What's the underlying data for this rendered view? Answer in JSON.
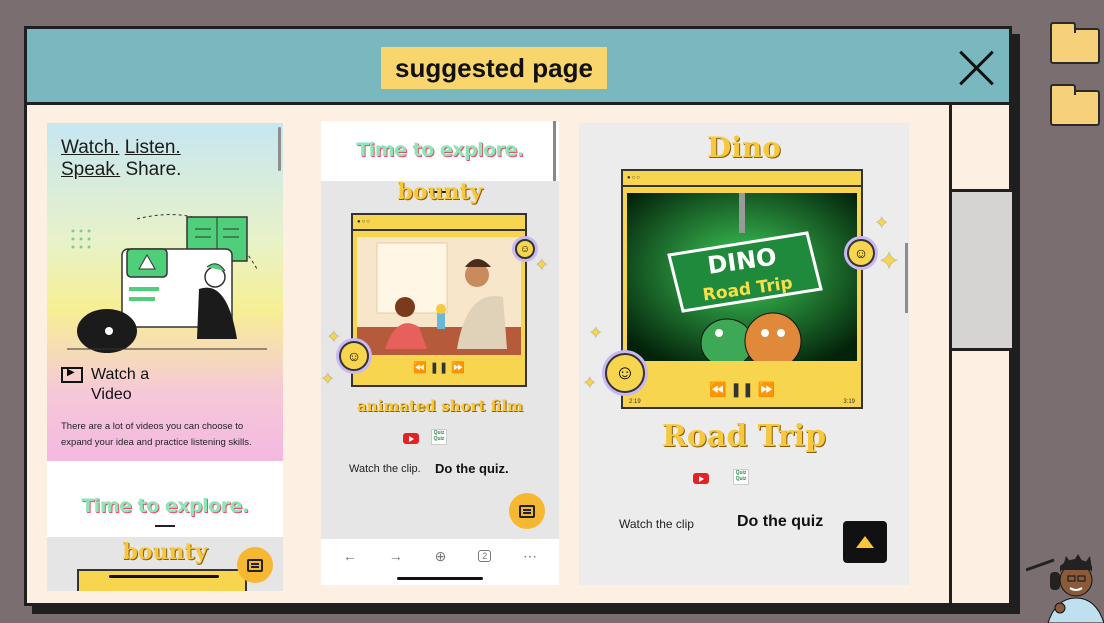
{
  "window": {
    "title": "suggested page"
  },
  "card1": {
    "heading_underlined_1": "Watch.",
    "heading_underlined_2": "Listen.",
    "heading_underlined_3": "Speak.",
    "heading_plain": "Share.",
    "watch_line1": "Watch a",
    "watch_line2": "Video",
    "description": "There are a lot of videos you can choose to expand your idea and practice listening skills.",
    "explore_title": "Time to explore.",
    "bounty_title": "bounty"
  },
  "card2": {
    "explore_title": "Time to explore.",
    "bounty_title": "bounty",
    "subtitle": "animated short film",
    "watch_label": "Watch the clip.",
    "quiz_label": "Do the quiz.",
    "player_controls": "⏪  ❚❚  ⏩",
    "nav_tab_count": "2",
    "quiz_icon_text": "Quiz Quiz"
  },
  "card3": {
    "title_top": "Dino",
    "title_bottom": "Road Trip",
    "sign_line1": "DINO",
    "sign_line2": "Road Trip",
    "watch_label": "Watch the clip",
    "quiz_label": "Do the quiz",
    "player_controls": "⏪  ❚❚  ⏩",
    "time_start": "2:19",
    "time_end": "3:19",
    "quiz_icon_text": "Quiz Quiz"
  },
  "colors": {
    "background": "#7b6e70",
    "titlebar": "#7ab8bf",
    "title_highlight": "#f8d66d",
    "window_body": "#fdf0e3",
    "accent_yellow": "#f8d54e",
    "explore_green": "#8ee6b8"
  },
  "icons": [
    "close-icon",
    "folder-icon",
    "chat-icon",
    "youtube-icon",
    "quiz-icon",
    "video-icon",
    "smiley-icon",
    "caret-up-icon"
  ]
}
